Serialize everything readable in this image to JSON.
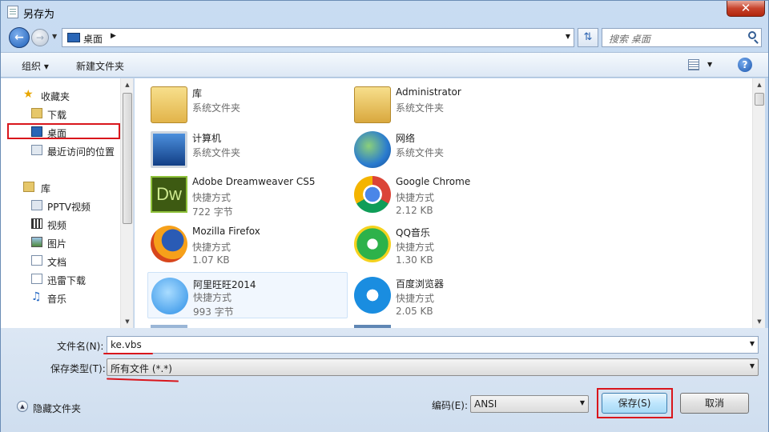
{
  "window": {
    "title": "另存为",
    "close_label": "✕"
  },
  "address": {
    "location": "桌面",
    "search_placeholder": "搜索 桌面"
  },
  "toolbar": {
    "organize_label": "组织 ▾",
    "new_folder_label": "新建文件夹",
    "help_label": "?"
  },
  "sidebar": {
    "items": [
      {
        "label": "收藏夹",
        "icon": "star-icon"
      },
      {
        "label": "下载",
        "icon": "download-folder-icon"
      },
      {
        "label": "桌面",
        "icon": "desktop-icon"
      },
      {
        "label": "最近访问的位置",
        "icon": "recent-places-icon"
      },
      {
        "label": "库",
        "icon": "library-icon"
      },
      {
        "label": "PPTV视频",
        "icon": "pptv-video-icon"
      },
      {
        "label": "视频",
        "icon": "video-library-icon"
      },
      {
        "label": "图片",
        "icon": "pictures-library-icon"
      },
      {
        "label": "文档",
        "icon": "documents-library-icon"
      },
      {
        "label": "迅雷下载",
        "icon": "thunder-download-icon"
      },
      {
        "label": "音乐",
        "icon": "music-library-icon"
      }
    ]
  },
  "files": [
    {
      "name": "库",
      "type": "系统文件夹",
      "size": "",
      "icon": "library-folder-icon"
    },
    {
      "name": "Administrator",
      "type": "系统文件夹",
      "size": "",
      "icon": "user-folder-icon"
    },
    {
      "name": "计算机",
      "type": "系统文件夹",
      "size": "",
      "icon": "computer-icon"
    },
    {
      "name": "网络",
      "type": "系统文件夹",
      "size": "",
      "icon": "network-icon"
    },
    {
      "name": "Adobe Dreamweaver CS5",
      "type": "快捷方式",
      "size": "722 字节",
      "icon": "dreamweaver-icon"
    },
    {
      "name": "Google Chrome",
      "type": "快捷方式",
      "size": "2.12 KB",
      "icon": "chrome-icon"
    },
    {
      "name": "Mozilla Firefox",
      "type": "快捷方式",
      "size": "1.07 KB",
      "icon": "firefox-icon"
    },
    {
      "name": "QQ音乐",
      "type": "快捷方式",
      "size": "1.30 KB",
      "icon": "qq-music-icon"
    },
    {
      "name": "阿里旺旺2014",
      "type": "快捷方式",
      "size": "993 字节",
      "icon": "aliwangwang-icon"
    },
    {
      "name": "百度浏览器",
      "type": "快捷方式",
      "size": "2.05 KB",
      "icon": "baidu-browser-icon"
    }
  ],
  "form": {
    "filename_label": "文件名(N):",
    "filename_value": "ke.vbs",
    "filetype_label": "保存类型(T):",
    "filetype_value": "所有文件  (*.*)",
    "encoding_label": "编码(E):",
    "encoding_value": "ANSI",
    "save_label": "保存(S)",
    "cancel_label": "取消",
    "hide_folders_label": "隐藏文件夹"
  },
  "colors": {
    "highlight_red": "#d9161c",
    "accent_blue": "#2a66b7"
  }
}
